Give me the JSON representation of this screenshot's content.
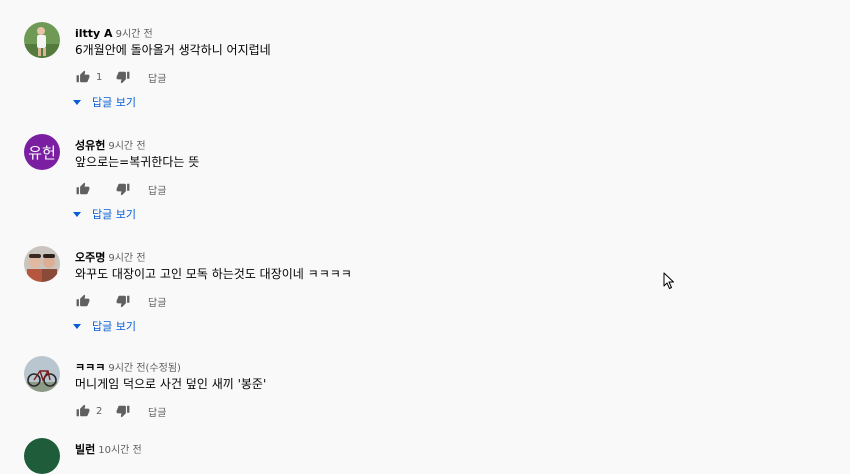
{
  "comments": [
    {
      "author": "iltty A",
      "time": "9시간 전",
      "text": "6개월안에 돌아올거 생각하니 어지럽네",
      "likes": "1",
      "reply_label": "답글",
      "view_replies": "답글 보기"
    },
    {
      "author": "성유헌",
      "avatar_text": "유헌",
      "time": "9시간 전",
      "text": "앞으로는=복귀한다는 뜻",
      "likes": "",
      "reply_label": "답글",
      "view_replies": "답글 보기"
    },
    {
      "author": "오주명",
      "time": "9시간 전",
      "text": "와꾸도 대장이고 고인 모독 하는것도 대장이네 ㅋㅋㅋㅋ",
      "likes": "",
      "reply_label": "답글",
      "view_replies": "답글 보기"
    },
    {
      "author": "ㅋㅋㅋ",
      "time": "9시간 전(수정됨)",
      "text": "머니게임 덕으로 사건 덮인 새끼 '봉준'",
      "likes": "2",
      "reply_label": "답글"
    },
    {
      "author": "빌런",
      "time": "10시간 전"
    }
  ],
  "colors": {
    "link": "#065fd4",
    "secondary": "#606060",
    "avatar_purple": "#7b1fa2"
  }
}
